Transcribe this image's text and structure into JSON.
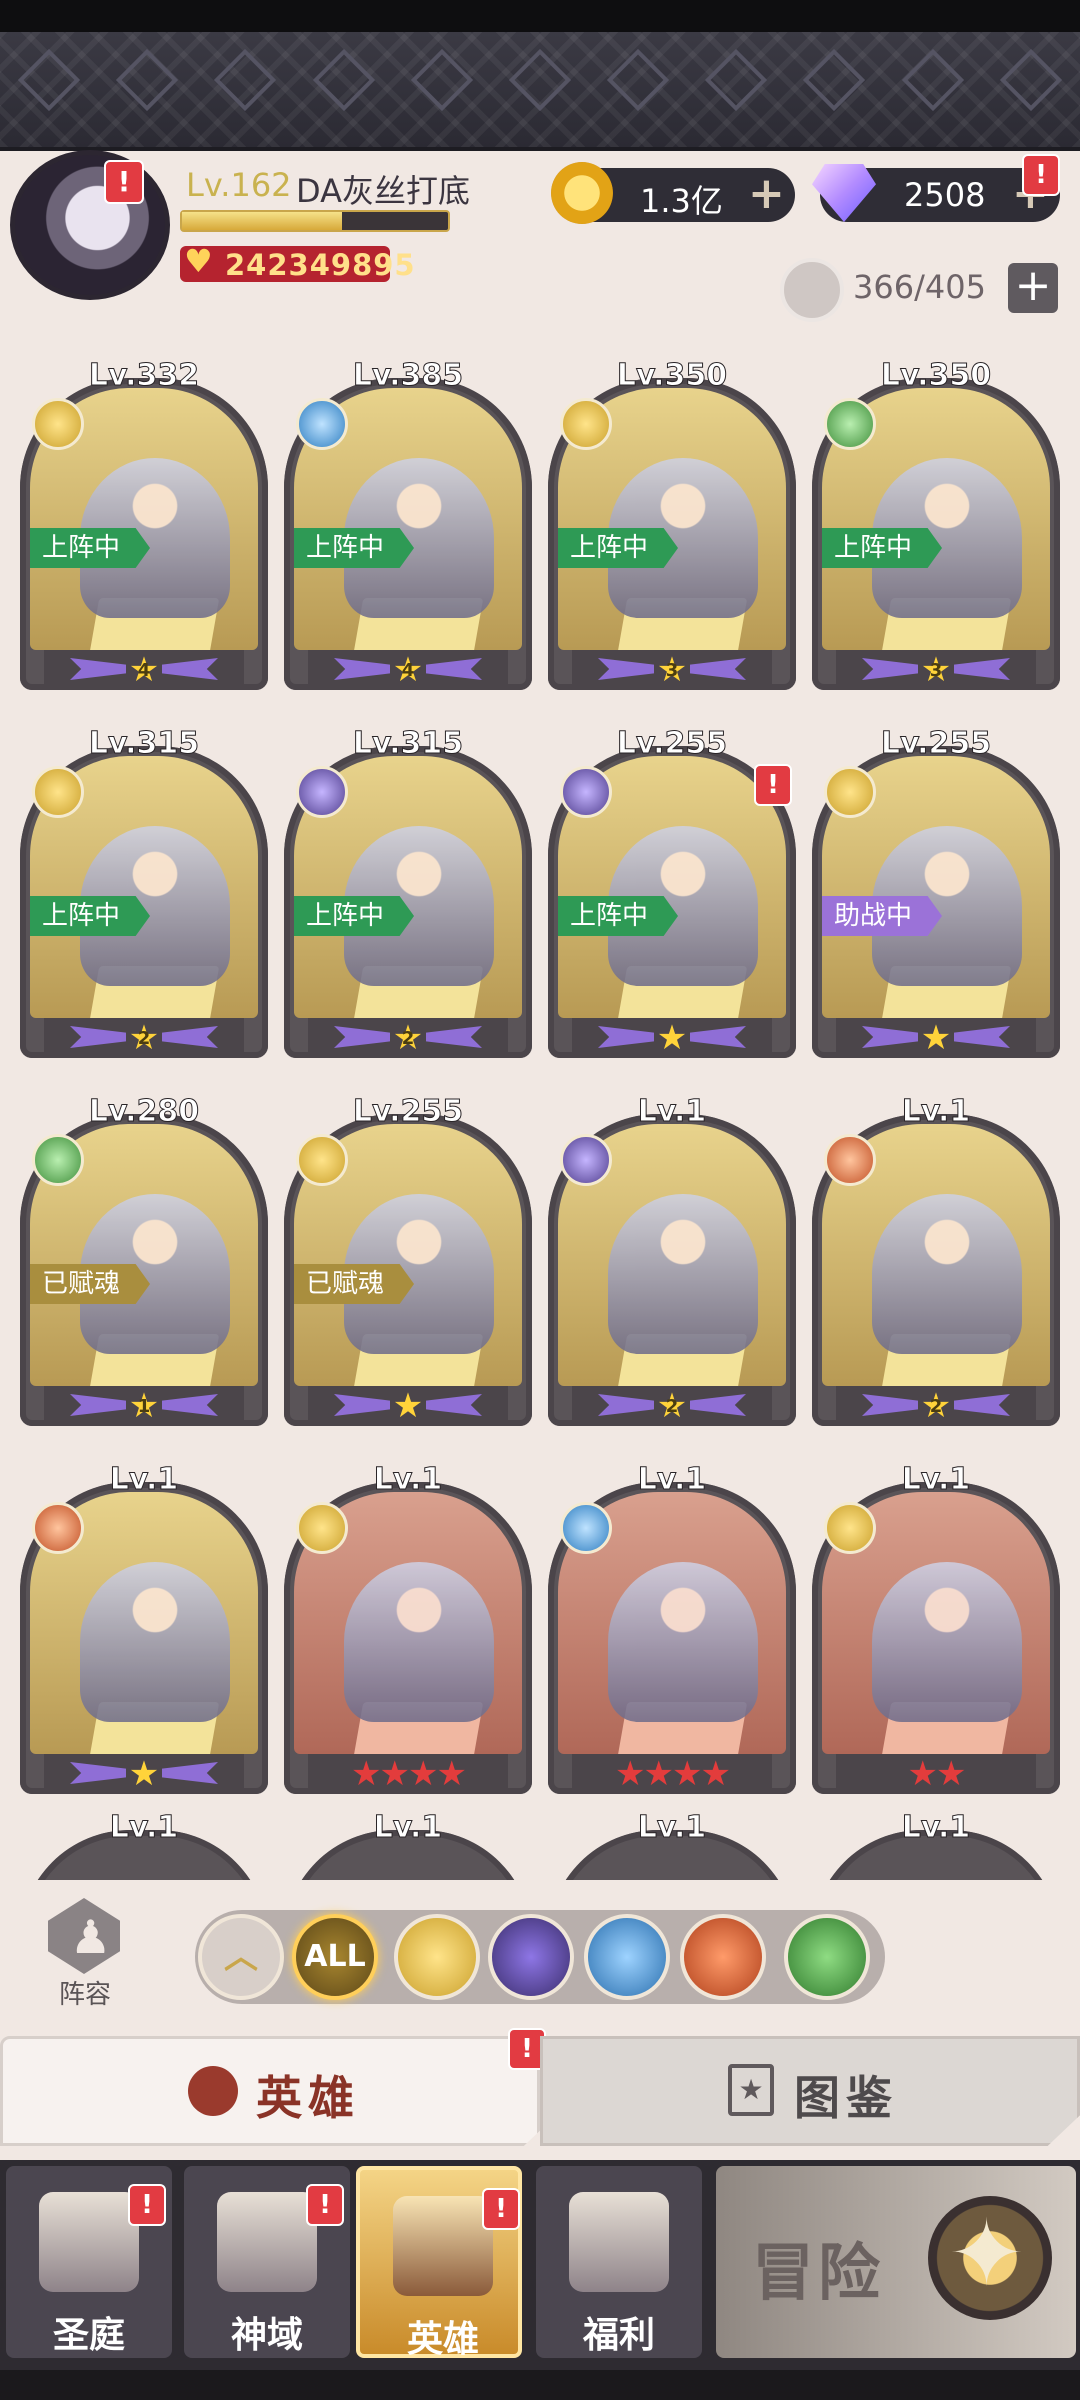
{
  "player": {
    "level": "Lv.162",
    "name": "DA灰丝打底",
    "power": "242349895",
    "exp_fraction": 0.6,
    "avatar_badge": "!"
  },
  "currency": {
    "gold": "1.3亿",
    "gems": "2508",
    "gold_icon": "gold-coin-icon",
    "gem_icon": "diamond-icon",
    "plus_label": "+",
    "gem_badge": "!"
  },
  "capacity": {
    "text": "366/405",
    "plus_label": "+"
  },
  "heroes": [
    {
      "level": "Lv.332",
      "faction": "gold",
      "status": "上阵中",
      "status_style": "green",
      "stars": "4",
      "star_style": "purple",
      "bg": "gold"
    },
    {
      "level": "Lv.385",
      "faction": "blue",
      "status": "上阵中",
      "status_style": "green",
      "stars": "4",
      "star_style": "purple",
      "bg": "gold"
    },
    {
      "level": "Lv.350",
      "faction": "gold",
      "status": "上阵中",
      "status_style": "green",
      "stars": "3",
      "star_style": "purple",
      "bg": "gold"
    },
    {
      "level": "Lv.350",
      "faction": "green",
      "status": "上阵中",
      "status_style": "green",
      "stars": "3",
      "star_style": "purple",
      "bg": "gold"
    },
    {
      "level": "Lv.315",
      "faction": "gold",
      "status": "上阵中",
      "status_style": "green",
      "stars": "2",
      "star_style": "purple",
      "bg": "gold"
    },
    {
      "level": "Lv.315",
      "faction": "purple",
      "status": "上阵中",
      "status_style": "green",
      "stars": "2",
      "star_style": "purple",
      "bg": "gold"
    },
    {
      "level": "Lv.255",
      "faction": "purple",
      "status": "上阵中",
      "status_style": "green",
      "stars": "",
      "star_style": "purple",
      "bg": "gold",
      "badge": "!"
    },
    {
      "level": "Lv.255",
      "faction": "gold",
      "status": "助战中",
      "status_style": "purple",
      "stars": "",
      "star_style": "purple",
      "bg": "gold"
    },
    {
      "level": "Lv.280",
      "faction": "green",
      "status": "已赋魂",
      "status_style": "olive",
      "stars": "1",
      "star_style": "purple",
      "bg": "gold"
    },
    {
      "level": "Lv.255",
      "faction": "gold",
      "status": "已赋魂",
      "status_style": "olive",
      "stars": "",
      "star_style": "purple",
      "bg": "gold"
    },
    {
      "level": "Lv.1",
      "faction": "purple",
      "status": "",
      "status_style": "",
      "stars": "2",
      "star_style": "purple",
      "bg": "gold"
    },
    {
      "level": "Lv.1",
      "faction": "orange",
      "status": "",
      "status_style": "",
      "stars": "2",
      "star_style": "purple",
      "bg": "gold"
    },
    {
      "level": "Lv.1",
      "faction": "orange",
      "status": "",
      "status_style": "",
      "stars": "",
      "star_style": "purple",
      "bg": "gold"
    },
    {
      "level": "Lv.1",
      "faction": "gold",
      "status": "",
      "status_style": "",
      "stars": "★★★★",
      "star_style": "red",
      "bg": "red"
    },
    {
      "level": "Lv.1",
      "faction": "blue",
      "status": "",
      "status_style": "",
      "stars": "★★★★",
      "star_style": "red",
      "bg": "red"
    },
    {
      "level": "Lv.1",
      "faction": "gold",
      "status": "",
      "status_style": "",
      "stars": "★★",
      "star_style": "red",
      "bg": "red"
    }
  ],
  "partial_row": [
    "Lv.1",
    "Lv.1",
    "Lv.1",
    "Lv.1"
  ],
  "lineup": {
    "label": "阵容",
    "icon": "chess-pawn-icon"
  },
  "filters": [
    {
      "name": "filter-up",
      "label": "︿",
      "style": "up"
    },
    {
      "name": "filter-all",
      "label": "ALL",
      "style": "all"
    },
    {
      "name": "filter-light",
      "label": "",
      "style": "gold"
    },
    {
      "name": "filter-dark",
      "label": "",
      "style": "purple"
    },
    {
      "name": "filter-holy",
      "label": "",
      "style": "blue"
    },
    {
      "name": "filter-beast",
      "label": "",
      "style": "orange"
    },
    {
      "name": "filter-nature",
      "label": "",
      "style": "green"
    }
  ],
  "tabs": {
    "hero": "英雄",
    "codex": "图鉴",
    "hero_badge": "!"
  },
  "nav": [
    {
      "label": "圣庭",
      "badge": "!"
    },
    {
      "label": "神域",
      "badge": "!"
    },
    {
      "label": "英雄",
      "badge": "!"
    },
    {
      "label": "福利",
      "badge": ""
    }
  ],
  "adventure": {
    "label": "冒险",
    "icon": "compass-star-icon"
  },
  "colors": {
    "accent_gold": "#c9a64b",
    "badge_red": "#e23b42",
    "deploy_green": "#2e9a55",
    "assist_purple": "#9b72d8"
  }
}
